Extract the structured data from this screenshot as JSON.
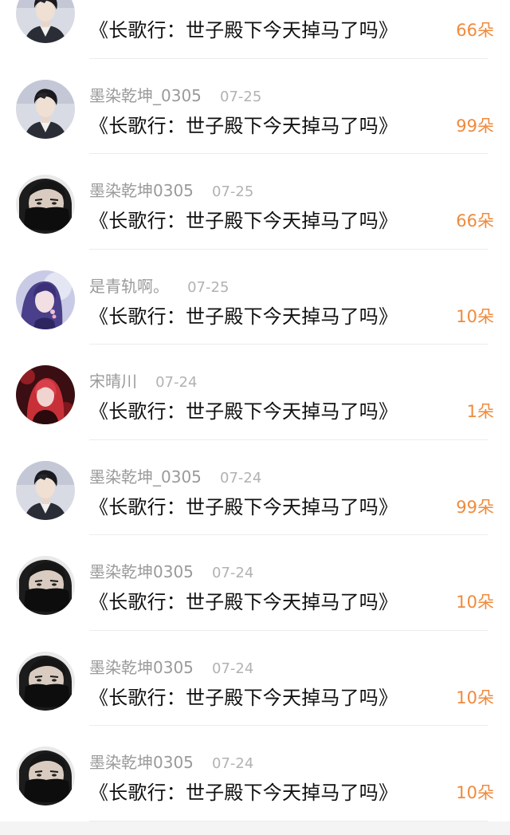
{
  "rows": [
    {
      "username": "",
      "date": "",
      "title": "《长歌行：世子殿下今天掉马了吗》",
      "count": "66朵",
      "avatar": "guqian-suit-avatar"
    },
    {
      "username": "墨染乾坤_0305",
      "date": "07-25",
      "title": "《长歌行：世子殿下今天掉马了吗》",
      "count": "99朵",
      "avatar": "guqian-suit-avatar"
    },
    {
      "username": "墨染乾坤0305",
      "date": "07-25",
      "title": "《长歌行：世子殿下今天掉马了吗》",
      "count": "66朵",
      "avatar": "masked-man-avatar"
    },
    {
      "username": "是青轨啊。",
      "date": "07-25",
      "title": "《长歌行：世子殿下今天掉马了吗》",
      "count": "10朵",
      "avatar": "purple-hair-avatar"
    },
    {
      "username": "宋晴川",
      "date": "07-24",
      "title": "《长歌行：世子殿下今天掉马了吗》",
      "count": "1朵",
      "avatar": "red-light-avatar"
    },
    {
      "username": "墨染乾坤_0305",
      "date": "07-24",
      "title": "《长歌行：世子殿下今天掉马了吗》",
      "count": "99朵",
      "avatar": "guqian-suit-avatar"
    },
    {
      "username": "墨染乾坤0305",
      "date": "07-24",
      "title": "《长歌行：世子殿下今天掉马了吗》",
      "count": "10朵",
      "avatar": "masked-man-avatar"
    },
    {
      "username": "墨染乾坤0305",
      "date": "07-24",
      "title": "《长歌行：世子殿下今天掉马了吗》",
      "count": "10朵",
      "avatar": "masked-man-avatar"
    },
    {
      "username": "墨染乾坤0305",
      "date": "07-24",
      "title": "《长歌行：世子殿下今天掉马了吗》",
      "count": "10朵",
      "avatar": "masked-man-avatar"
    }
  ],
  "colors": {
    "accent": "#f08a3c",
    "username": "#9a9a9a",
    "date": "#b2b2b2",
    "title": "#111111"
  }
}
